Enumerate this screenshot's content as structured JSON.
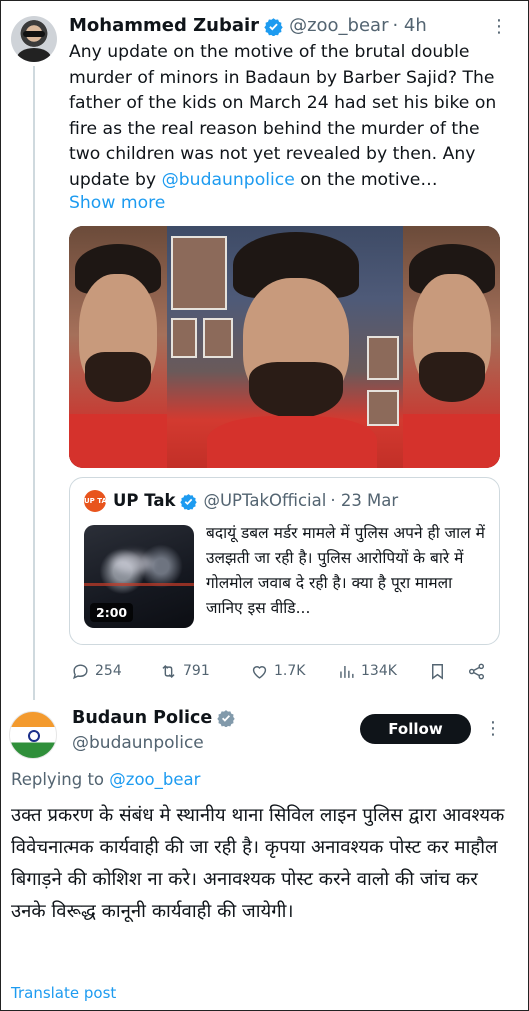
{
  "tweet1": {
    "author_name": "Mohammed Zubair",
    "handle": "@zoo_bear",
    "time": "· 4h",
    "more": "·",
    "text_before_mention": "Any update on the motive of the brutal double murder of minors in Badaun by Barber Sajid? The father of the kids on March 24 had set his bike on fire as the real reason behind the murder of the two children was not yet revealed by then. Any update by ",
    "mention": "@budaunpolice",
    "text_after_mention": " on the motive…",
    "show_more": "Show more",
    "quote": {
      "logo_text": "UP TAK",
      "author_name": "UP Tak",
      "handle": "@UPTakOfficial",
      "time": "· 23 Mar",
      "text": "बदायूं डबल मर्डर मामले में पुलिस अपने ही जाल में उलझती जा रही है। पुलिस आरोपियों के बारे में गोलमोल जवाब दे रही है। क्या है पूरा मामला जानिए इस वीडि...",
      "video_duration": "2:00"
    },
    "actions": {
      "replies": "254",
      "reposts": "791",
      "likes": "1.7K",
      "views": "134K"
    }
  },
  "tweet2": {
    "author_name": "Budaun Police",
    "handle": "@budaunpolice",
    "follow_label": "Follow",
    "replying_prefix": "Replying to ",
    "replying_to": "@zoo_bear",
    "text": "उक्त प्रकरण के संबंध मे स्थानीय थाना सिविल लाइन पुलिस द्वारा आवश्यक विवेचनात्मक कार्यवाही की जा रही है। कृपया अनावश्यक पोस्ट कर माहौल बिगाड़ने की कोशिश ना करे। अनावश्यक पोस्ट करने वालो की जांच कर उनके विरूद्ध कानूनी कार्यवाही की जायेगी।",
    "translate": "Translate post"
  },
  "colors": {
    "link": "#1d9bf0",
    "secondary_text": "#536471",
    "primary_text": "#0f1419",
    "verified_badge": "#1d9bf0",
    "follow_button": "#0f1419"
  }
}
